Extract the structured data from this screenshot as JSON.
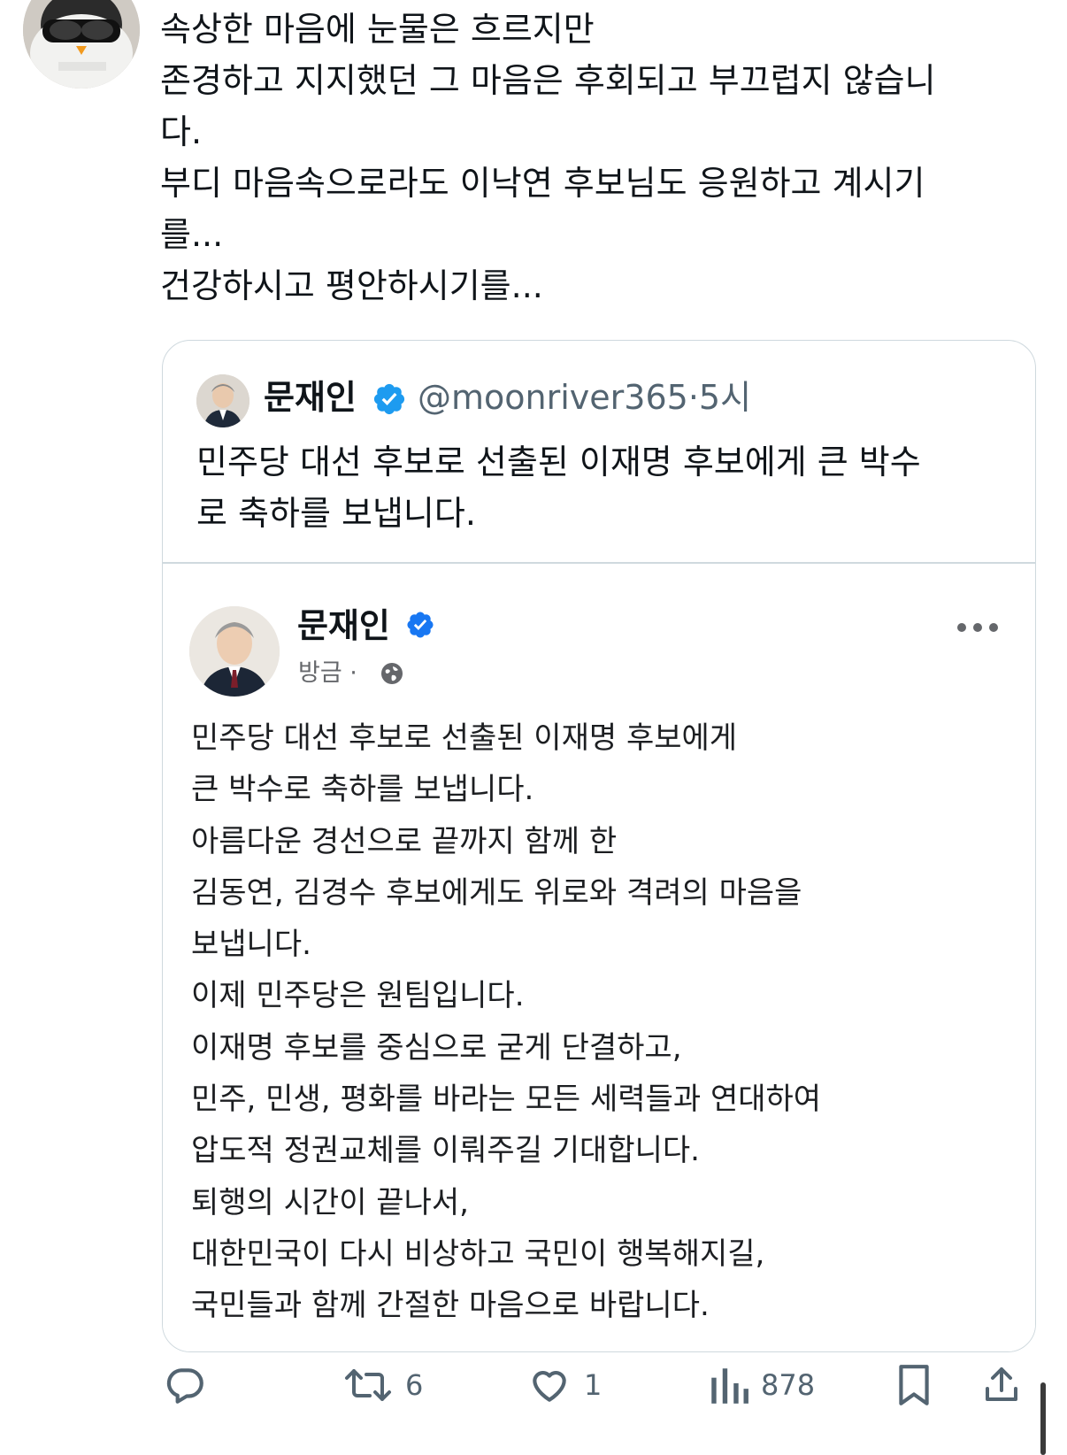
{
  "post": {
    "lines": [
      "속상한 마음에 눈물은 흐르지만",
      "존경하고 지지했던 그 마음은 후회되고 부끄럽지 않습니",
      "다.",
      "부디 마음속으로라도 이낙연 후보님도 응원하고 계시기",
      "를...",
      "건강하시고 평안하시기를..."
    ]
  },
  "quoted": {
    "author_name": "문재인",
    "handle": "@moonriver365",
    "separator": "·",
    "time": "5시",
    "text_lines": [
      "민주당 대선 후보로 선출된 이재명 후보에게 큰 박수",
      "로 축하를 보냅니다."
    ],
    "embed": {
      "author_name": "문재인",
      "time": "방금",
      "separator": "·",
      "lines": [
        "민주당 대선 후보로 선출된 이재명 후보에게",
        "큰 박수로 축하를 보냅니다.",
        "아름다운 경선으로 끝까지 함께 한",
        "김동연, 김경수 후보에게도 위로와 격려의 마음을",
        "보냅니다.",
        "이제 민주당은 원팀입니다.",
        "이재명 후보를 중심으로 굳게 단결하고,",
        "민주, 민생, 평화를 바라는 모든 세력들과 연대하여",
        "압도적 정권교체를 이뤄주길 기대합니다.",
        "퇴행의 시간이 끝나서,",
        "대한민국이 다시 비상하고 국민이 행복해지길,",
        "국민들과 함께 간절한 마음으로 바랍니다."
      ]
    }
  },
  "actions": {
    "reply_icon": "speech-bubble-icon",
    "retweet_icon": "retweet-icon",
    "retweets": "6",
    "like_icon": "heart-icon",
    "likes": "1",
    "views_icon": "bar-chart-icon",
    "views": "878",
    "bookmark_icon": "bookmark-icon",
    "share_icon": "share-icon"
  },
  "colors": {
    "text": "#0f1419",
    "muted": "#536471",
    "verified": "#1d9bf0",
    "fb_verified": "#1877f2",
    "border": "#cfd9de"
  }
}
